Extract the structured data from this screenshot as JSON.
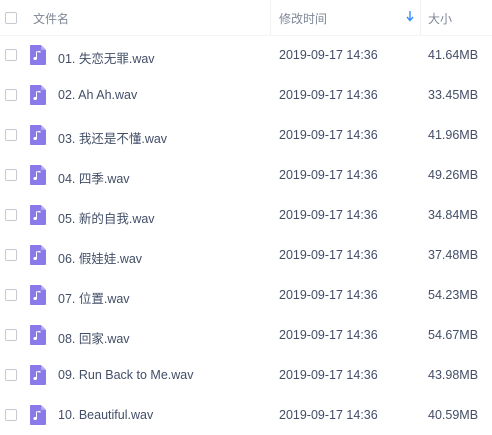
{
  "header": {
    "name_label": "文件名",
    "modified_label": "修改时间",
    "size_label": "大小"
  },
  "file_icon": "music-file-icon",
  "accent_color": "#8a79e8",
  "files": [
    {
      "name": "01. 失恋无罪.wav",
      "modified": "2019-09-17 14:36",
      "size": "41.64MB"
    },
    {
      "name": "02. Ah Ah.wav",
      "modified": "2019-09-17 14:36",
      "size": "33.45MB"
    },
    {
      "name": "03. 我还是不懂.wav",
      "modified": "2019-09-17 14:36",
      "size": "41.96MB"
    },
    {
      "name": "04. 四季.wav",
      "modified": "2019-09-17 14:36",
      "size": "49.26MB"
    },
    {
      "name": "05. 新的自我.wav",
      "modified": "2019-09-17 14:36",
      "size": "34.84MB"
    },
    {
      "name": "06. 假娃娃.wav",
      "modified": "2019-09-17 14:36",
      "size": "37.48MB"
    },
    {
      "name": "07. 位置.wav",
      "modified": "2019-09-17 14:36",
      "size": "54.23MB"
    },
    {
      "name": "08. 回家.wav",
      "modified": "2019-09-17 14:36",
      "size": "54.67MB"
    },
    {
      "name": "09. Run Back to Me.wav",
      "modified": "2019-09-17 14:36",
      "size": "43.98MB"
    },
    {
      "name": "10. Beautiful.wav",
      "modified": "2019-09-17 14:36",
      "size": "40.59MB"
    }
  ]
}
